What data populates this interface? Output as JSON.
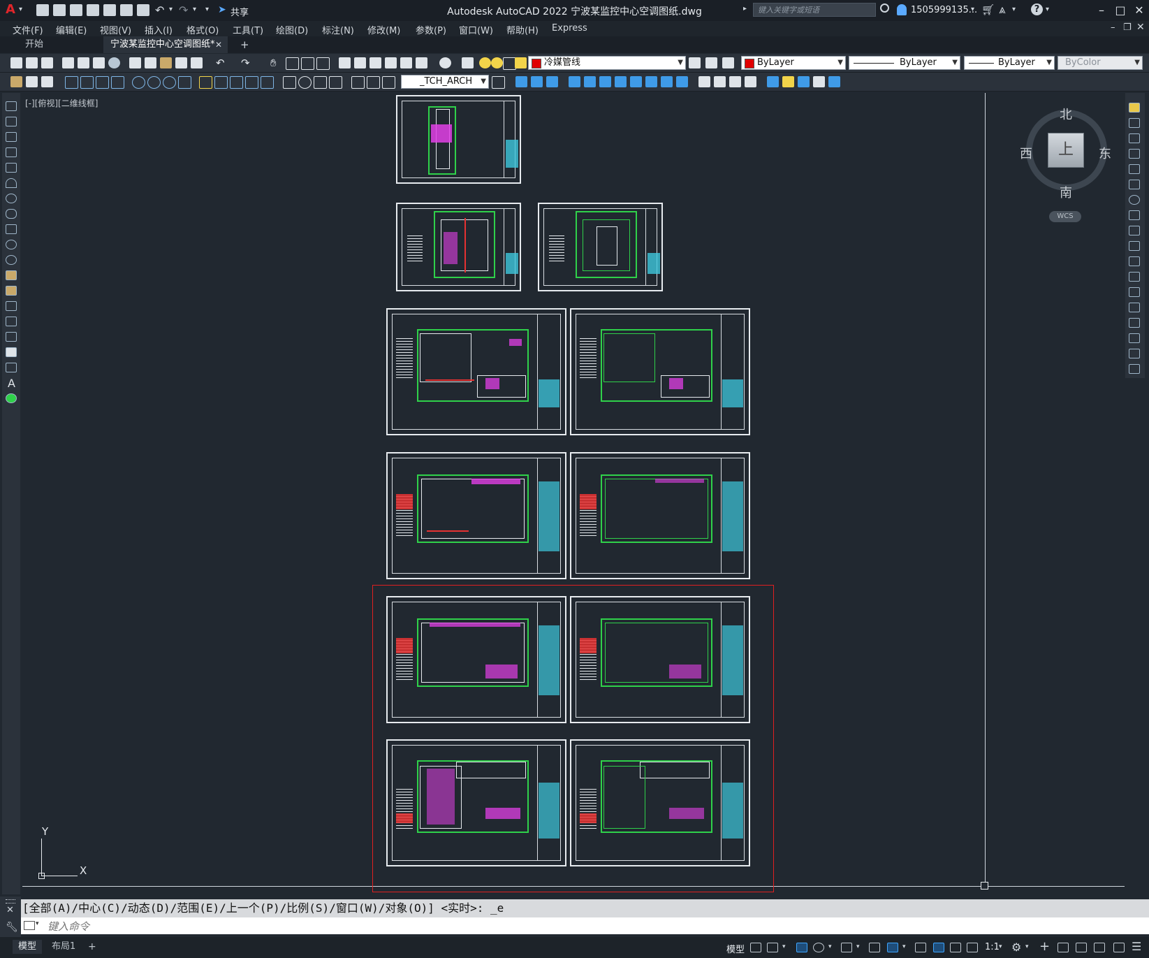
{
  "titlebar": {
    "app_title": "Autodesk AutoCAD 2022    宁波某监控中心空调图纸.dwg",
    "share_label": "共享",
    "search_placeholder": "键入关键字或短语",
    "user_name": "1505999135...",
    "help_glyph": "?"
  },
  "menu": {
    "items": [
      "文件(F)",
      "编辑(E)",
      "视图(V)",
      "插入(I)",
      "格式(O)",
      "工具(T)",
      "绘图(D)",
      "标注(N)",
      "修改(M)",
      "参数(P)",
      "窗口(W)",
      "帮助(H)",
      "Express"
    ]
  },
  "tabs": {
    "start_label": "开始",
    "active_label": "宁波某监控中心空调图纸*",
    "close_glyph": "✕",
    "add_glyph": "+"
  },
  "toolbar": {
    "layer_name": "冷媒管线",
    "color_value": "ByLayer",
    "linetype_value": "ByLayer",
    "lineweight_value": "ByLayer",
    "plotstyle_value": "ByColor",
    "textstyle_value": "_TCH_ARCH"
  },
  "viewport": {
    "label": "[-][俯视][二维线框]"
  },
  "viewcube": {
    "north": "北",
    "south": "南",
    "east": "东",
    "west": "西",
    "face": "上",
    "wcs": "WCS"
  },
  "ucs": {
    "x": "X",
    "y": "Y"
  },
  "command": {
    "history": "[全部(A)/中心(C)/动态(D)/范围(E)/上一个(P)/比例(S)/窗口(W)/对象(O)] <实时>: _e",
    "placeholder": "键入命令"
  },
  "status": {
    "model_tab": "模型",
    "layout_tab": "布局1",
    "add_glyph": "+",
    "model_button": "模型",
    "scale": "1:1"
  },
  "colors": {
    "background": "#212830",
    "plan_green": "#2fd14a",
    "duct_magenta": "#e23fe6",
    "selection_red": "#e02020",
    "annotation_cyan": "#3ec7dd"
  }
}
